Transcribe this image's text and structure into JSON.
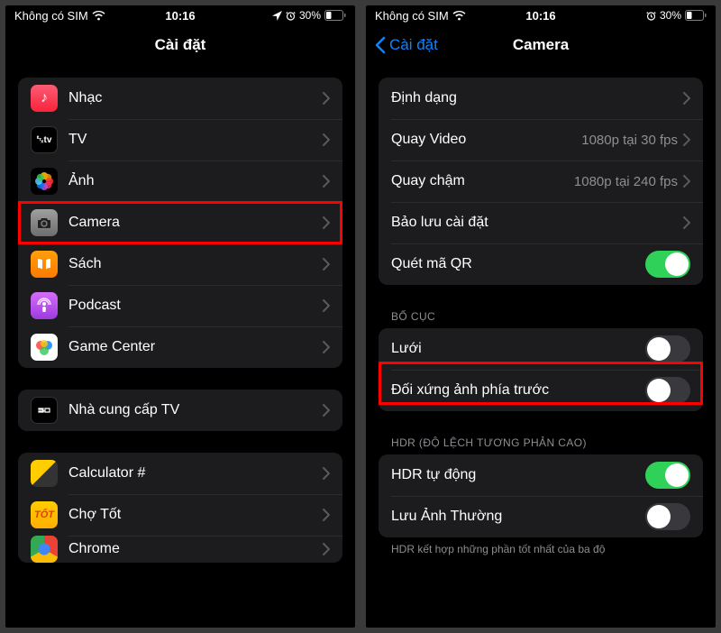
{
  "status": {
    "carrier": "Không có SIM",
    "time": "10:16",
    "battery_pct": "30%"
  },
  "left": {
    "title": "Cài đặt",
    "group1": [
      {
        "label": "Nhạc"
      },
      {
        "label": "TV"
      },
      {
        "label": "Ảnh"
      },
      {
        "label": "Camera",
        "highlight": true
      },
      {
        "label": "Sách"
      },
      {
        "label": "Podcast"
      },
      {
        "label": "Game Center"
      }
    ],
    "group2": [
      {
        "label": "Nhà cung cấp TV"
      }
    ],
    "group3": [
      {
        "label": "Calculator #"
      },
      {
        "label": "Chợ Tốt"
      },
      {
        "label": "Chrome"
      }
    ]
  },
  "right": {
    "back_label": "Cài đặt",
    "title": "Camera",
    "group1": [
      {
        "label": "Định dạng",
        "kind": "nav"
      },
      {
        "label": "Quay Video",
        "detail": "1080p tại 30 fps",
        "kind": "nav"
      },
      {
        "label": "Quay chậm",
        "detail": "1080p tại 240 fps",
        "kind": "nav"
      },
      {
        "label": "Bảo lưu cài đặt",
        "kind": "nav"
      },
      {
        "label": "Quét mã QR",
        "kind": "toggle",
        "on": true
      }
    ],
    "section2_header": "BỐ CỤC",
    "group2": [
      {
        "label": "Lưới",
        "kind": "toggle",
        "on": false,
        "highlight": true
      },
      {
        "label": "Đối xứng ảnh phía trước",
        "kind": "toggle",
        "on": false
      }
    ],
    "section3_header": "HDR (ĐỘ LỆCH TƯƠNG PHẢN CAO)",
    "group3": [
      {
        "label": "HDR tự động",
        "kind": "toggle",
        "on": true
      },
      {
        "label": "Lưu Ảnh Thường",
        "kind": "toggle",
        "on": false
      }
    ],
    "footer": "HDR kết hợp những phần tốt nhất của ba độ"
  }
}
